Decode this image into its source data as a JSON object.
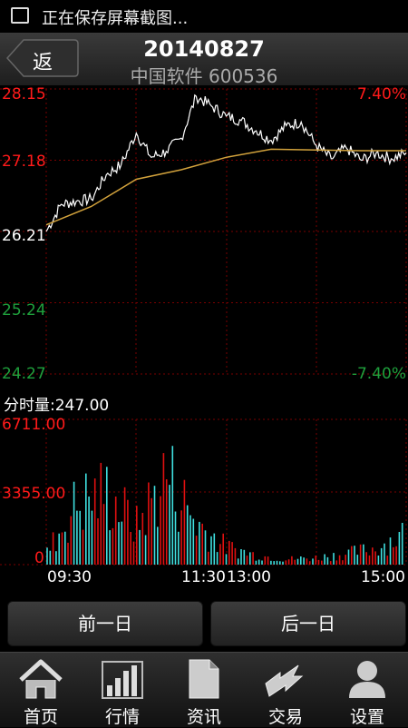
{
  "status_bar": {
    "text": "正在保存屏幕截图..."
  },
  "header": {
    "back_label": "返",
    "date": "20140827",
    "stock_name": "中国软件",
    "stock_code": "600536"
  },
  "price_axis": {
    "left_labels": [
      "28.15",
      "27.18",
      "26.21",
      "25.24",
      "24.27"
    ],
    "right_top": "7.40%",
    "right_bottom": "-7.40%"
  },
  "volume": {
    "title": "分时量:247.00",
    "labels": [
      "6711.00",
      "3355.00",
      "0"
    ]
  },
  "time_axis": {
    "labels": [
      "09:30",
      "11:30",
      "13:00",
      "15:00"
    ]
  },
  "colors": {
    "up": "#ff1a1a",
    "down": "#1fa03c",
    "prev_close": "#ffffff",
    "grid": "#7a0000",
    "avg_line": "#d2a23c",
    "vol_up": "#e01010",
    "vol_down": "#3fe0e0"
  },
  "navigation": {
    "prev_day": "前一日",
    "next_day": "后一日"
  },
  "tabs": [
    {
      "label": "首页",
      "icon": "home-icon"
    },
    {
      "label": "行情",
      "icon": "bar-chart-icon"
    },
    {
      "label": "资讯",
      "icon": "document-icon"
    },
    {
      "label": "交易",
      "icon": "exchange-arrows-icon"
    },
    {
      "label": "设置",
      "icon": "user-icon"
    }
  ],
  "chart_data": {
    "type": "line",
    "series": [
      {
        "name": "",
        "x": [
          "09:30",
          "09:40",
          "09:50",
          "10:00",
          "10:10",
          "10:20",
          "10:30",
          "10:40",
          "10:50",
          "11:00",
          "11:10",
          "11:20",
          "11:30",
          "13:10",
          "13:20",
          "13:30",
          "13:40",
          "13:50",
          "14:00",
          "14:10",
          "14:20",
          "14:30",
          "14:40",
          "14:50",
          "15:00"
        ],
        "values": [
          26.21,
          26.58,
          26.62,
          26.65,
          26.98,
          27.12,
          27.55,
          27.22,
          27.3,
          27.48,
          28.05,
          27.92,
          27.78,
          27.72,
          27.58,
          27.45,
          27.65,
          27.7,
          27.38,
          27.2,
          27.35,
          27.18,
          27.28,
          27.2,
          27.28
        ]
      },
      {
        "name": "",
        "x": [
          "09:30",
          "10:00",
          "10:30",
          "11:00",
          "11:30",
          "13:30",
          "14:00",
          "14:30",
          "15:00"
        ],
        "values": [
          26.3,
          26.55,
          26.92,
          27.05,
          27.22,
          27.33,
          27.32,
          27.31,
          27.31
        ]
      }
    ],
    "ylim": [
      24.27,
      28.15
    ],
    "y_ticks": [
      "28.15",
      "27.18",
      "26.21",
      "25.24",
      "24.27"
    ],
    "x_ticks": [
      "09:30",
      "11:30",
      "13:00",
      "15:00"
    ],
    "volume": {
      "ylim": [
        0,
        6711.0
      ],
      "peaks": [
        900,
        4500,
        5300,
        2800,
        6711,
        3100,
        1300,
        700,
        400,
        500,
        800,
        1200,
        2300
      ]
    }
  }
}
